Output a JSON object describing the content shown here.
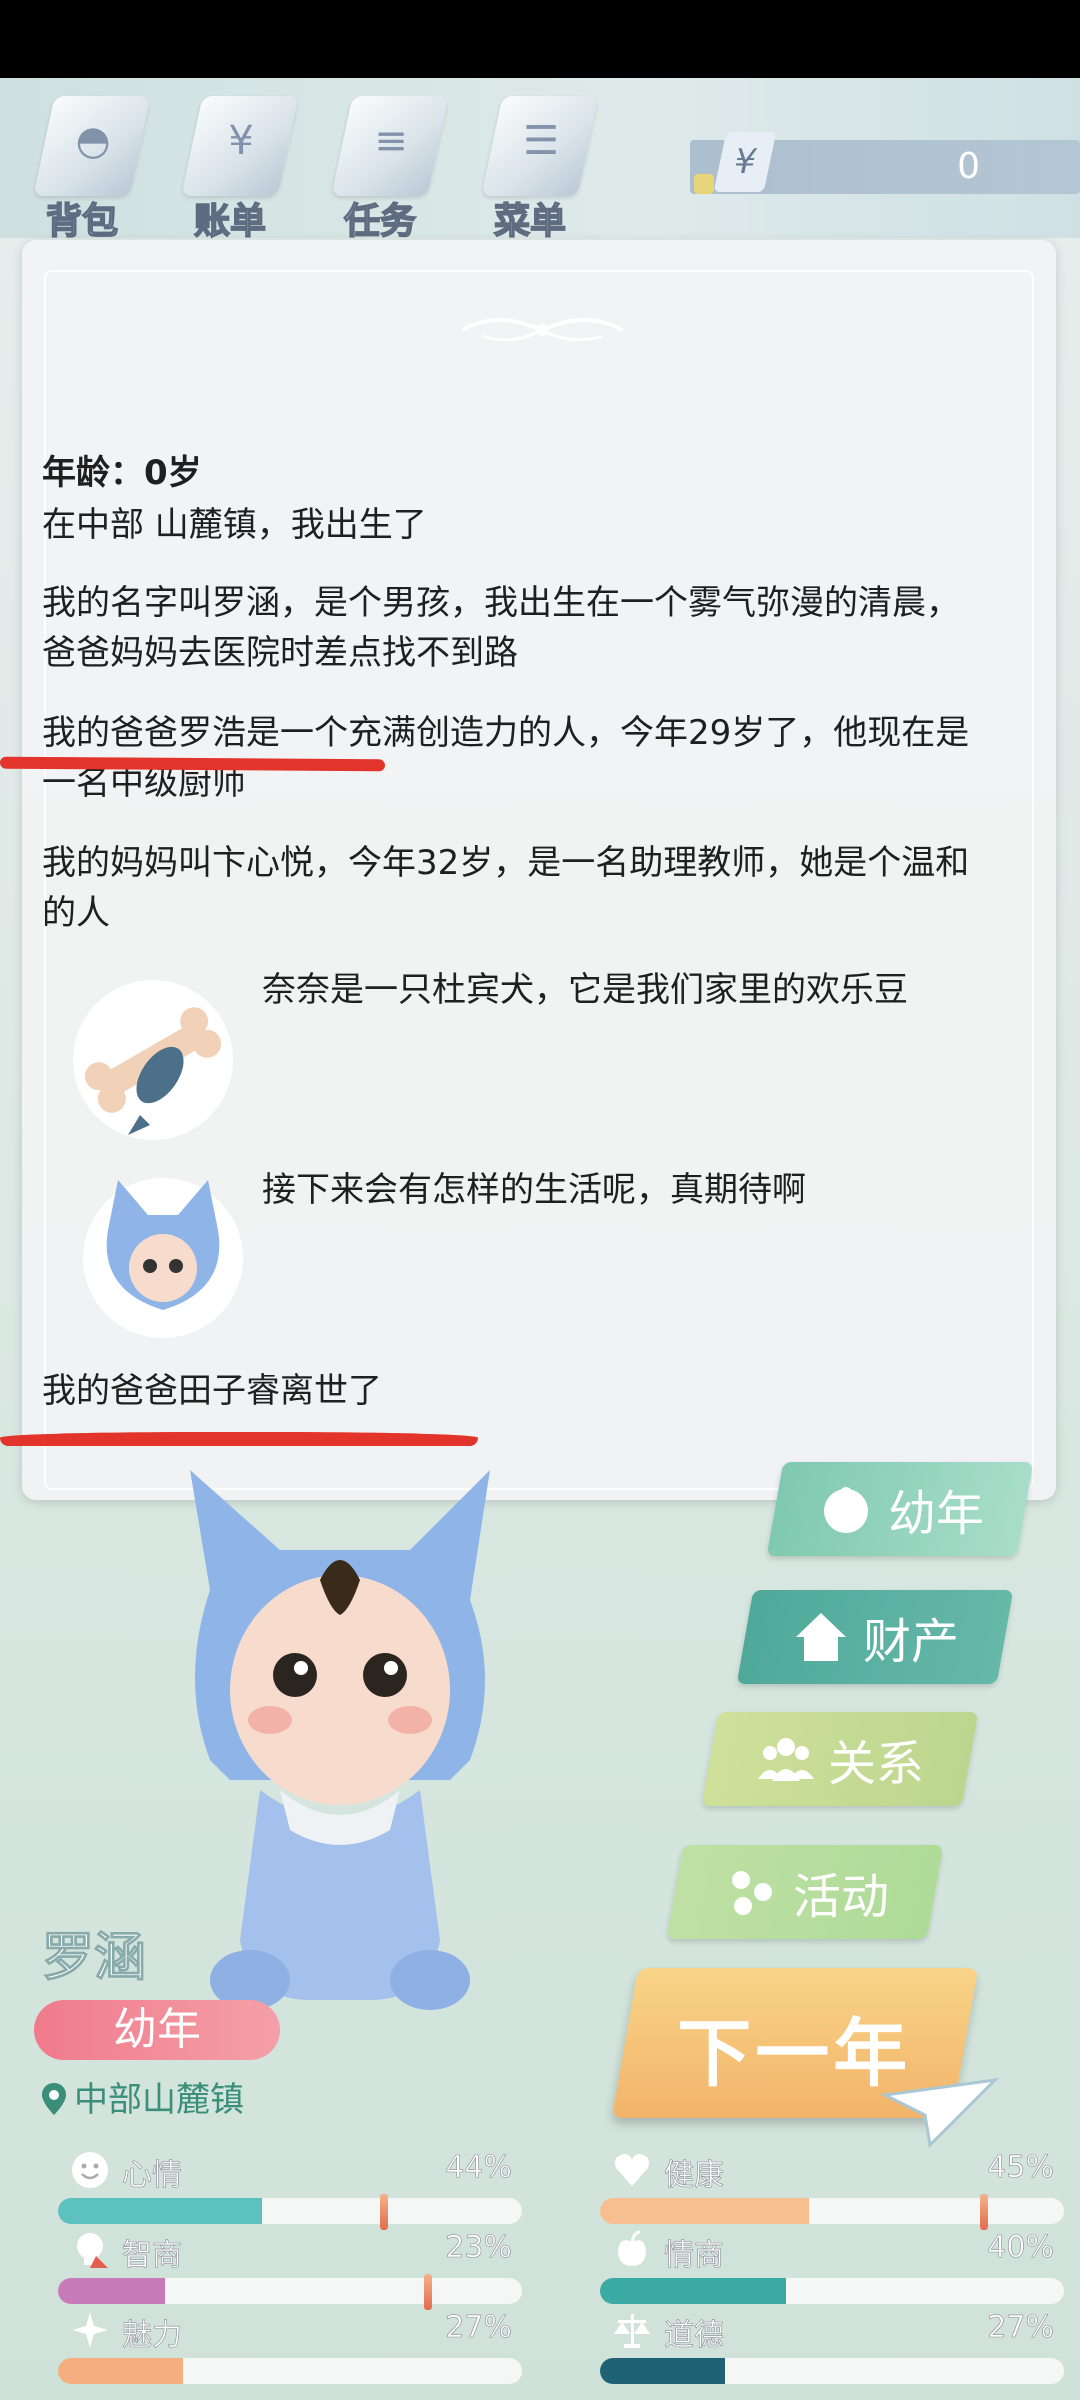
{
  "toolbar": {
    "items": [
      {
        "label": "背包",
        "icon": "backpack-icon"
      },
      {
        "label": "账单",
        "icon": "bill-icon"
      },
      {
        "label": "任务",
        "icon": "task-icon"
      },
      {
        "label": "菜单",
        "icon": "menu-icon"
      }
    ],
    "money_symbol": "¥",
    "money": "0"
  },
  "story": {
    "age": "年龄：0岁",
    "born": "在中部 山麓镇，我出生了",
    "p1": "我的名字叫罗涵，是个男孩，我出生在一个雾气弥漫的清晨，爸爸妈妈去医院时差点找不到路",
    "p2": "我的爸爸罗浩是一个充满创造力的人，今年29岁了，他现在是一名中级厨师",
    "p3": "我的妈妈叫卞心悦，今年32岁，是一名助理教师，她是个温和的人",
    "pet_text": "奈奈是一只杜宾犬，它是我们家里的欢乐豆",
    "future_text": "接下来会有怎样的生活呢，真期待啊",
    "last": "我的爸爸田子睿离世了"
  },
  "actions": {
    "stage": "幼年",
    "property": "财产",
    "relations": "关系",
    "activities": "活动",
    "next_year": "下一年"
  },
  "character": {
    "name": "罗涵",
    "stage": "幼年",
    "location": "中部山麓镇"
  },
  "stats": [
    {
      "label": "心情",
      "value": "44%",
      "fraction": 0.44,
      "color": "#5cc1bf",
      "icon": "smiley-icon"
    },
    {
      "label": "健康",
      "value": "45%",
      "fraction": 0.45,
      "color": "#f7bf8f",
      "icon": "heart-icon"
    },
    {
      "label": "智商",
      "value": "23%",
      "fraction": 0.23,
      "color": "#c87bb9",
      "icon": "bulb-icon"
    },
    {
      "label": "情商",
      "value": "40%",
      "fraction": 0.4,
      "color": "#3aaaa2",
      "icon": "apple-icon"
    },
    {
      "label": "魅力",
      "value": "27%",
      "fraction": 0.27,
      "color": "#f4ae80",
      "icon": "sparkle-icon"
    },
    {
      "label": "道德",
      "value": "27%",
      "fraction": 0.27,
      "color": "#1f6276",
      "icon": "scale-icon"
    }
  ]
}
